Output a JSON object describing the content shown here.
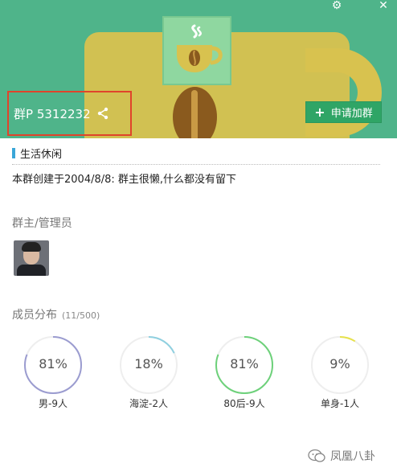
{
  "header": {
    "group_id": "群P 5312232",
    "apply_button": "申请加群",
    "colors": {
      "header_bg": "#4fb48a",
      "apply_bg": "#2fa566",
      "highlight_border": "#e0442b"
    }
  },
  "info": {
    "category": "生活休闲",
    "description": "本群创建于2004/8/8: 群主很懒,什么都没有留下"
  },
  "admins": {
    "title": "群主/管理员"
  },
  "distribution": {
    "title": "成员分布",
    "count": "(11/500)",
    "stats": [
      {
        "percent": "81%",
        "label": "男-9人",
        "fraction": 0.81,
        "color": "#9b9cd0"
      },
      {
        "percent": "18%",
        "label": "海淀-2人",
        "fraction": 0.18,
        "color": "#8fd0e0"
      },
      {
        "percent": "81%",
        "label": "80后-9人",
        "fraction": 0.81,
        "color": "#6dd17a"
      },
      {
        "percent": "9%",
        "label": "单身-1人",
        "fraction": 0.09,
        "color": "#e7e24a"
      }
    ]
  },
  "watermark": {
    "text": "凤凰八卦"
  }
}
